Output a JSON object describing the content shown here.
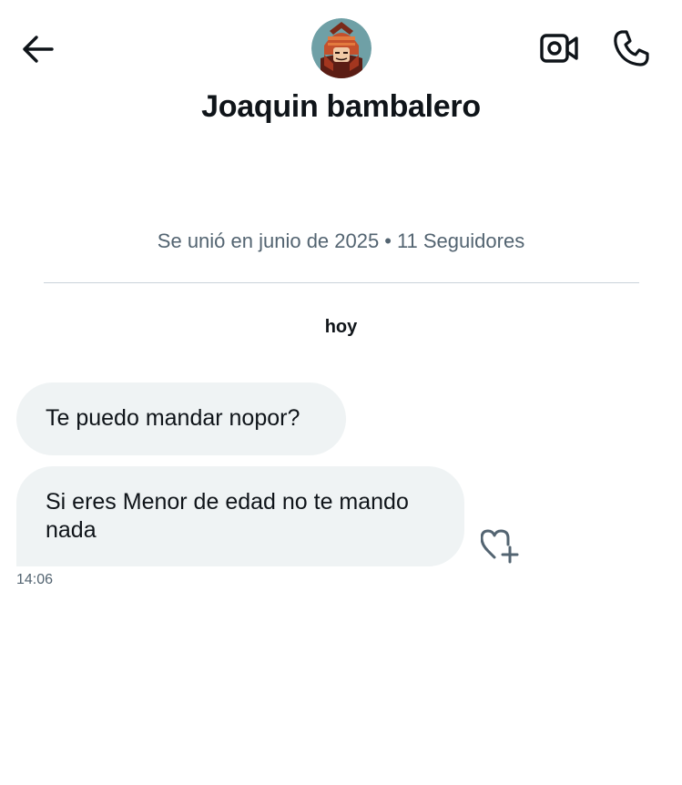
{
  "header": {
    "back_icon": "arrow-left-icon",
    "video_icon": "video-camera-icon",
    "call_icon": "phone-icon",
    "avatar_icon": "samurai-avatar",
    "contact_name": "Joaquin bambalero"
  },
  "profile": {
    "joined": "Se unió en junio de 2025",
    "separator": "•",
    "followers": "11 Seguidores"
  },
  "conversation": {
    "date_label": "hoy",
    "messages": [
      {
        "text": "Te puedo mandar nopor?"
      },
      {
        "text": "Si eres Menor de edad no te mando nada"
      }
    ],
    "last_timestamp": "14:06",
    "react_icon": "heart-plus-icon"
  },
  "colors": {
    "text_primary": "#0f1419",
    "text_secondary": "#536471",
    "bubble_bg": "#eff3f4",
    "divider": "#c9d3da"
  }
}
